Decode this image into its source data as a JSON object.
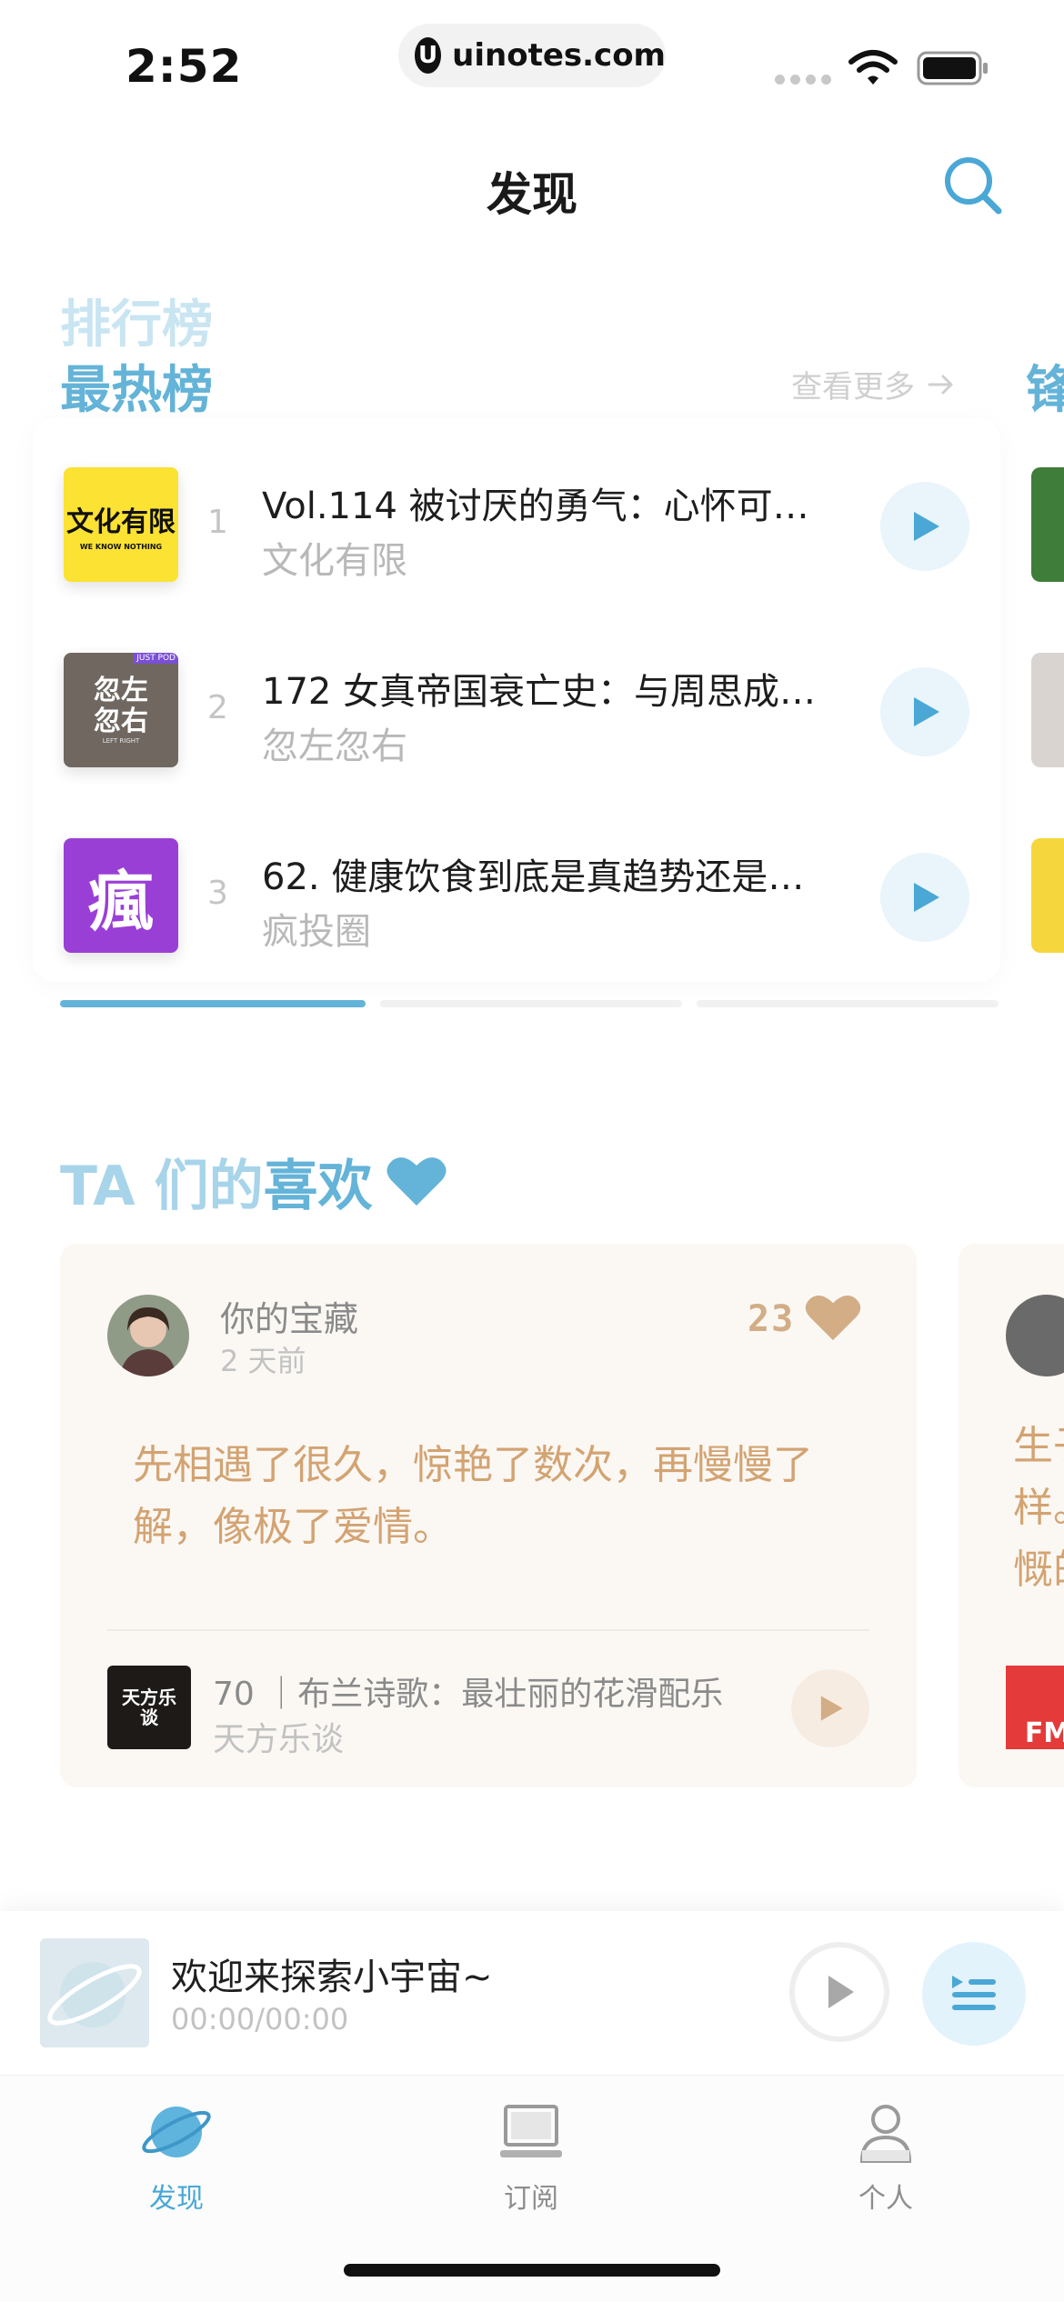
{
  "status_bar": {
    "time": "2:52",
    "url": "uinotes.com",
    "url_logo": "U"
  },
  "nav": {
    "title": "发现",
    "search_icon": "search-icon"
  },
  "ranking": {
    "super_title": "排行榜",
    "title": "最热榜",
    "more_label": "查看更多",
    "next_title_peek": "锋",
    "items": [
      {
        "rank": "1",
        "episode": "Vol.114 被讨厌的勇气：心怀可…",
        "show": "文化有限",
        "cover_text": "文化有限",
        "cover_sub": "WE KNOW NOTHING",
        "cover_bg": "#fbe233"
      },
      {
        "rank": "2",
        "episode": "172 女真帝国衰亡史：与周思成…",
        "show": "忽左忽右",
        "cover_text": "忽左忽右",
        "cover_sub": "LEFT RIGHT",
        "cover_badge": "JUST POD",
        "cover_bg": "#6f6760"
      },
      {
        "rank": "3",
        "episode": "62. 健康饮食到底是真趋势还是…",
        "show": "疯投圈",
        "cover_text": "瘋",
        "cover_bg": "#9a3fd6"
      }
    ],
    "accent_color": "#64b3d8"
  },
  "likes": {
    "title_prefix": "TA 们的",
    "title_strong": "喜欢",
    "card": {
      "user_name": "你的宝藏",
      "time_ago": "2 天前",
      "like_count": "23",
      "quote": "先相遇了很久，惊艳了数次，再慢慢了解，像极了爱情。",
      "episode": "70 ｜布兰诗歌：最壮丽的花滑配乐",
      "show": "天方乐谈",
      "mini_cover_text": "天方乐谈"
    },
    "peek_card": {
      "lines": [
        "生子",
        "样。",
        "慨的"
      ],
      "cover_text": "FM"
    },
    "quote_color": "#d3a372"
  },
  "mini_player": {
    "title": "欢迎来探索小宇宙~",
    "time": "00:00/00:00"
  },
  "tabbar": {
    "tabs": [
      {
        "label": "发现",
        "icon": "planet-icon",
        "active": true
      },
      {
        "label": "订阅",
        "icon": "laptop-icon",
        "active": false
      },
      {
        "label": "个人",
        "icon": "person-icon",
        "active": false
      }
    ],
    "active_color": "#4aa7d6"
  }
}
